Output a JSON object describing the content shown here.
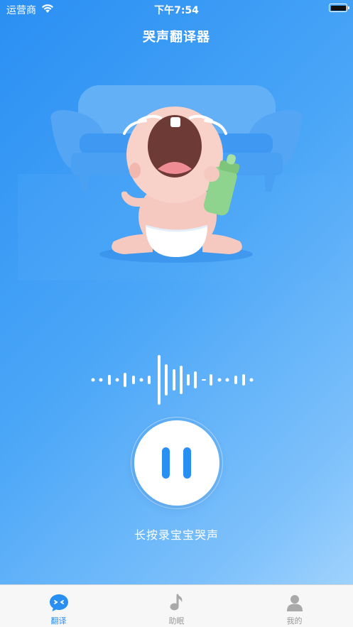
{
  "status_bar": {
    "carrier": "运营商",
    "time": "下午7:54"
  },
  "header": {
    "title": "哭声翻译器"
  },
  "hero": {
    "image": "crying-baby-with-bottle-on-sofa"
  },
  "recorder": {
    "state": "paused",
    "hint": "长按录宝宝哭声"
  },
  "tabs": [
    {
      "label": "翻译",
      "icon": "chat-translate-icon",
      "active": true
    },
    {
      "label": "助眠",
      "icon": "music-note-icon",
      "active": false
    },
    {
      "label": "我的",
      "icon": "person-icon",
      "active": false
    }
  ],
  "colors": {
    "accent": "#2a8ff3",
    "tab_inactive": "#9a9a9a",
    "background_start": "#2a8ff3",
    "background_end": "#a8d7fd"
  }
}
